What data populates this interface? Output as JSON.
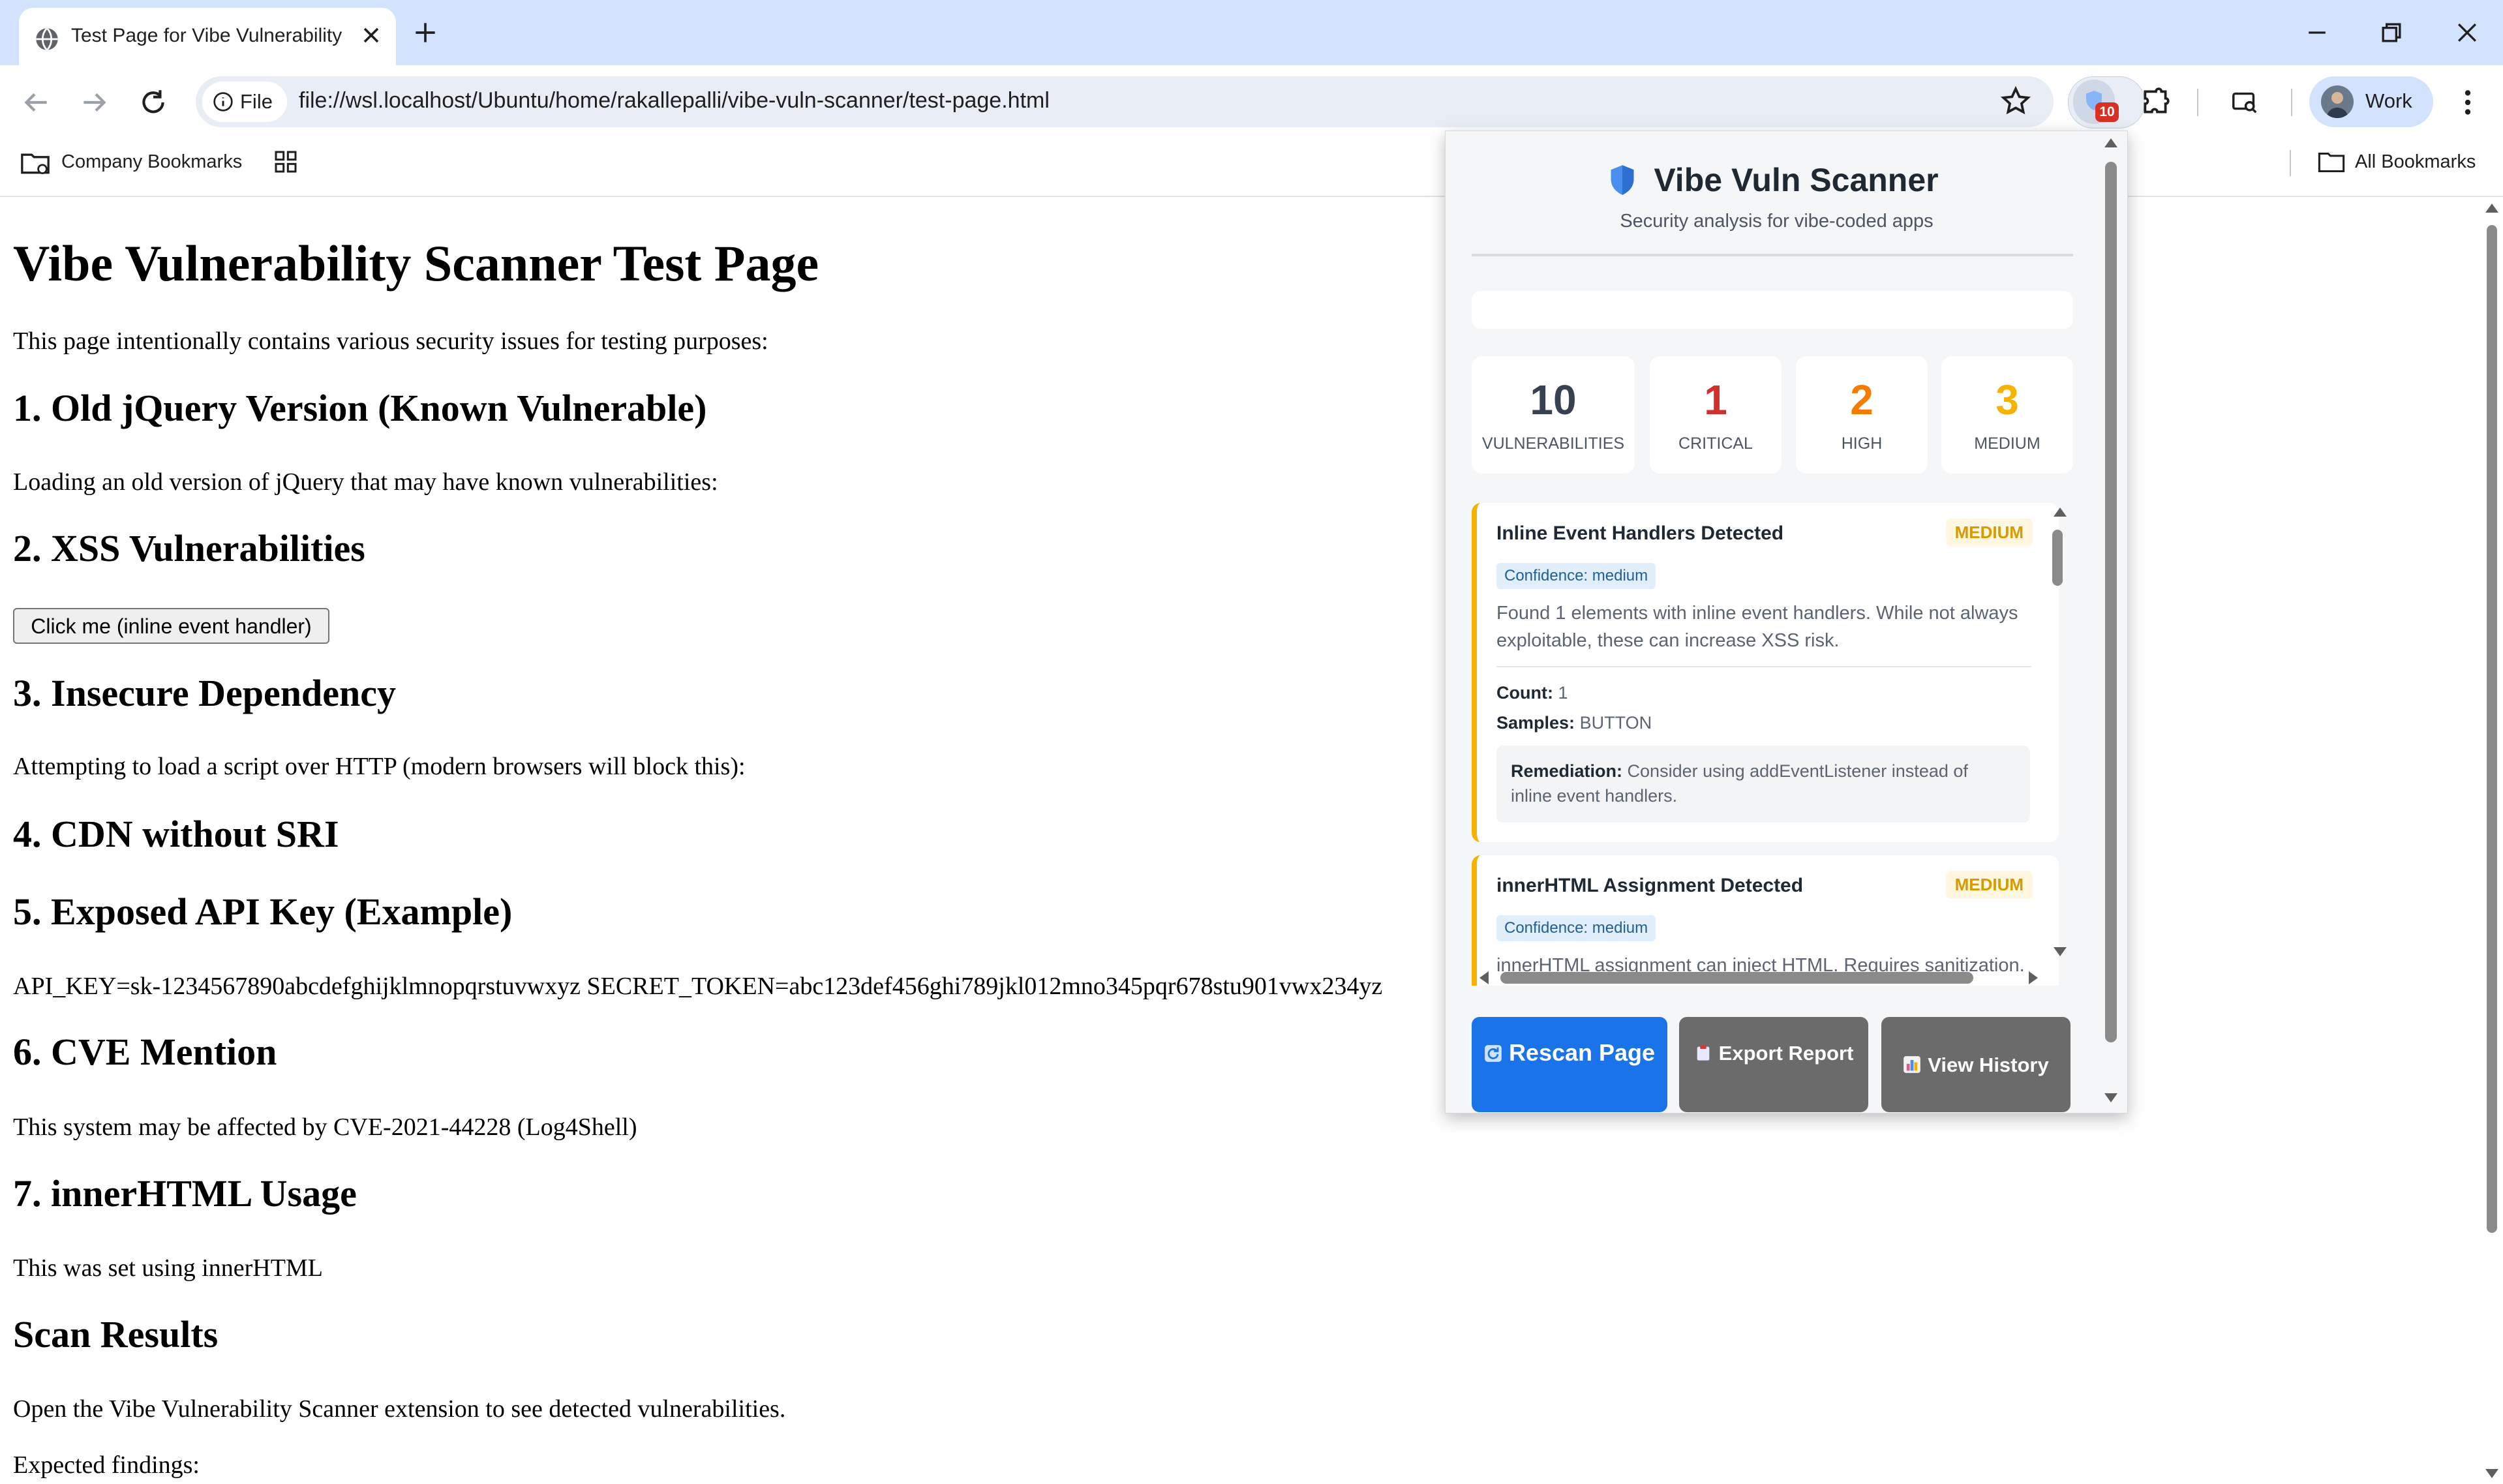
{
  "browser": {
    "tab_title": "Test Page for Vibe Vulnerability",
    "url": "file://wsl.localhost/Ubuntu/home/rakallepalli/vibe-vuln-scanner/test-page.html",
    "site_chip": "File",
    "extension_badge": "10",
    "profile_name": "Work",
    "bookmarks": {
      "company": "Company Bookmarks",
      "all": "All Bookmarks"
    }
  },
  "page": {
    "h1": "Vibe Vulnerability Scanner Test Page",
    "intro": "This page intentionally contains various security issues for testing purposes:",
    "s1_heading": "1. Old jQuery Version (Known Vulnerable)",
    "s1_text": "Loading an old version of jQuery that may have known vulnerabilities:",
    "s2_heading": "2. XSS Vulnerabilities",
    "s2_button": "Click me (inline event handler)",
    "s3_heading": "3. Insecure Dependency",
    "s3_text": "Attempting to load a script over HTTP (modern browsers will block this):",
    "s4_heading": "4. CDN without SRI",
    "s5_heading": "5. Exposed API Key (Example)",
    "s5_text": "API_KEY=sk-1234567890abcdefghijklmnopqrstuvwxyz SECRET_TOKEN=abc123def456ghi789jkl012mno345pqr678stu901vwx234yz",
    "s6_heading": "6. CVE Mention",
    "s6_text": "This system may be affected by CVE-2021-44228 (Log4Shell)",
    "s7_heading": "7. innerHTML Usage",
    "s7_text": "This was set using innerHTML",
    "results_heading": "Scan Results",
    "results_text": "Open the Vibe Vulnerability Scanner extension to see detected vulnerabilities.",
    "expected": "Expected findings:"
  },
  "popup": {
    "title": "Vibe Vuln Scanner",
    "subtitle": "Security analysis for vibe-coded apps",
    "stats": [
      {
        "value": "10",
        "label": "VULNERABILITIES",
        "color": "#374151"
      },
      {
        "value": "1",
        "label": "CRITICAL",
        "color": "#d32f2f"
      },
      {
        "value": "2",
        "label": "HIGH",
        "color": "#f57c00"
      },
      {
        "value": "3",
        "label": "MEDIUM",
        "color": "#f5b300"
      }
    ],
    "findings": [
      {
        "title": "Inline Event Handlers Detected",
        "severity": "MEDIUM",
        "confidence": "Confidence: medium",
        "description": "Found 1 elements with inline event handlers. While not always exploitable, these can increase XSS risk.",
        "count_label": "Count:",
        "count_value": "1",
        "samples_label": "Samples:",
        "samples_value": "BUTTON",
        "remediation_label": "Remediation:",
        "remediation_text": "Consider using addEventListener instead of inline event handlers."
      },
      {
        "title": "innerHTML Assignment Detected",
        "severity": "MEDIUM",
        "confidence": "Confidence: medium",
        "description": "innerHTML assignment can inject HTML. Requires sanitization."
      }
    ],
    "buttons": {
      "rescan": "Rescan Page",
      "export": "Export Report",
      "history": "View History"
    }
  }
}
